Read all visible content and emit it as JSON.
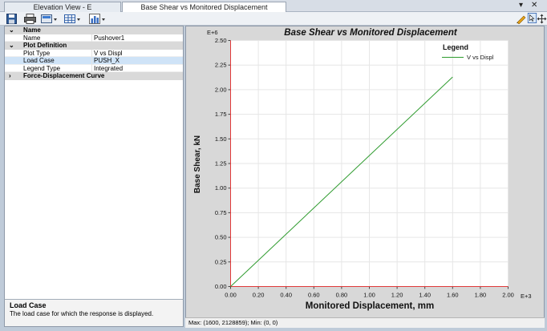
{
  "tabs": [
    {
      "label": "Elevation View - E",
      "active": false
    },
    {
      "label": "Base Shear vs Monitored Displacement",
      "active": true
    }
  ],
  "tab_controls": {
    "dropdown": "▾",
    "close": "✕"
  },
  "toolbar": {
    "left_icons": [
      "save-icon",
      "print-icon",
      "export-icon",
      "table-icon",
      "bar-chart-icon"
    ],
    "right_icons": [
      "pencil-icon",
      "select-icon",
      "pan-icon"
    ]
  },
  "property_grid": {
    "rows": [
      {
        "type": "category",
        "expander": "⌄",
        "label": "Name"
      },
      {
        "type": "item",
        "label": "Name",
        "value": "Pushover1"
      },
      {
        "type": "category",
        "expander": "⌄",
        "label": "Plot Definition"
      },
      {
        "type": "item",
        "label": "Plot Type",
        "value": "V vs Displ"
      },
      {
        "type": "item",
        "label": "Load Case",
        "value": "PUSH_X",
        "selected": true
      },
      {
        "type": "item",
        "label": "Legend Type",
        "value": "Integrated"
      },
      {
        "type": "category",
        "expander": "›",
        "label": "Force-Displacement Curve"
      }
    ]
  },
  "description": {
    "title": "Load Case",
    "text": "The load case for which the response is displayed."
  },
  "status": {
    "text": "Max: (1600, 2128859);   Min: (0, 0)"
  },
  "colors": {
    "series": "#2e9b2e",
    "axis_zero": "#e03a3a",
    "grid": "#e6e6e6"
  },
  "chart_data": {
    "type": "line",
    "title": "Base Shear vs Monitored Displacement",
    "xlabel": "Monitored Displacement, mm",
    "ylabel": "Base Shear, kN",
    "x_multiplier": "E+3",
    "y_multiplier": "E+6",
    "xlim": [
      0,
      2.0
    ],
    "ylim": [
      0,
      2.5
    ],
    "x_ticks": [
      "0.00",
      "0.20",
      "0.40",
      "0.60",
      "0.80",
      "1.00",
      "1.20",
      "1.40",
      "1.60",
      "1.80",
      "2.00"
    ],
    "y_ticks": [
      "0.00",
      "0.25",
      "0.50",
      "0.75",
      "1.00",
      "1.25",
      "1.50",
      "1.75",
      "2.00",
      "2.25",
      "2.50"
    ],
    "grid": true,
    "legend": {
      "title": "Legend",
      "placement": "top-right"
    },
    "series": [
      {
        "name": "V vs Displ",
        "x": [
          0,
          1.6
        ],
        "y": [
          0,
          2.128859
        ]
      }
    ]
  }
}
